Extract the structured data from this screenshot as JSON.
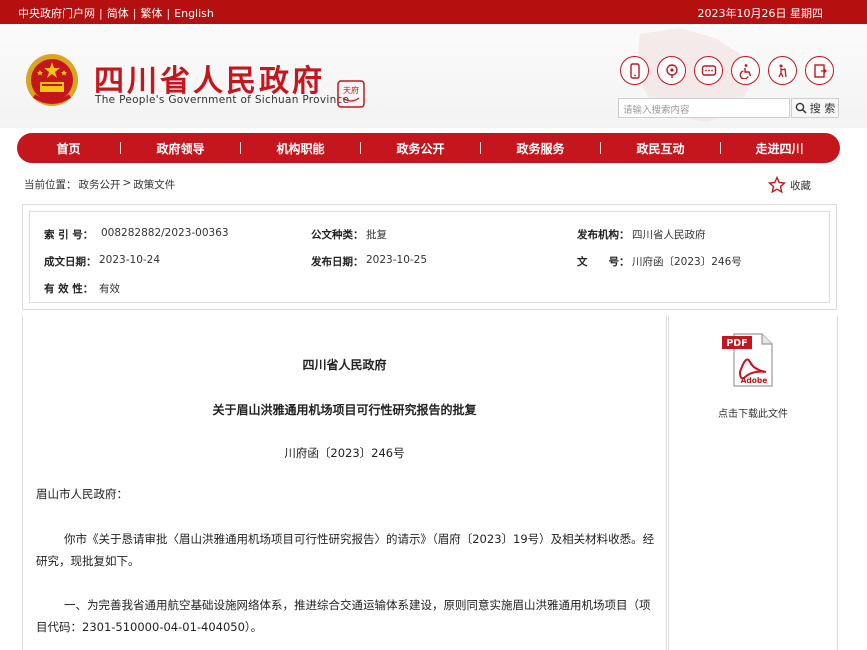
{
  "topbar": {
    "links": [
      "中央政府门户网",
      "简体",
      "繁体",
      "English"
    ],
    "separator": "|",
    "date": "2023年10月26日 星期四"
  },
  "header": {
    "title": "四川省人民政府",
    "subtitle": "The People's Government of Sichuan Province",
    "seal_text": "天府",
    "icons": [
      "mobile-icon",
      "weibo-icon",
      "wechat-icon",
      "accessibility-icon",
      "elderly-care-icon",
      "exit-icon"
    ],
    "search_placeholder": "请输入搜索内容",
    "search_label": "搜 索"
  },
  "nav": {
    "items": [
      "首页",
      "政府领导",
      "机构职能",
      "政务公开",
      "政务服务",
      "政民互动",
      "走进四川"
    ],
    "divider": "|"
  },
  "breadcrumb": {
    "prefix": "当前位置：",
    "items": [
      "政务公开",
      "政策文件"
    ],
    "separator": ">"
  },
  "favorite_label": "收藏",
  "meta": {
    "index_label": "索 引 号：",
    "index_value": "008282882/2023-00363",
    "type_label": "公文种类：",
    "type_value": "批复",
    "issuer_label": "发布机构：",
    "issuer_value": "四川省人民政府",
    "created_label": "成文日期：",
    "created_value": "2023-10-24",
    "published_label": "发布日期：",
    "published_value": "2023-10-25",
    "docno_label": "文　　号：",
    "docno_value": "川府函〔2023〕246号",
    "validity_label": "有 效 性：",
    "validity_value": "有效"
  },
  "document": {
    "issuer": "四川省人民政府",
    "title": "关于眉山洪雅通用机场项目可行性研究报告的批复",
    "number": "川府函〔2023〕246号",
    "salutation": "眉山市人民政府：",
    "para1": "你市《关于恳请审批〈眉山洪雅通用机场项目可行性研究报告〉的请示》（眉府〔2023〕19号）及相关材料收悉。经研究，现批复如下。",
    "para2": "一、为完善我省通用航空基础设施网络体系，推进综合交通运输体系建设，原则同意实施眉山洪雅通用机场项目（项目代码：2301-510000-04-01-404050）。"
  },
  "sidebar": {
    "pdf_badge": "PDF",
    "pdf_brand": "Adobe",
    "download_label": "点击下载此文件"
  },
  "colors": {
    "brand_red": "#c4161c",
    "topbar_red": "#b50f0f"
  }
}
